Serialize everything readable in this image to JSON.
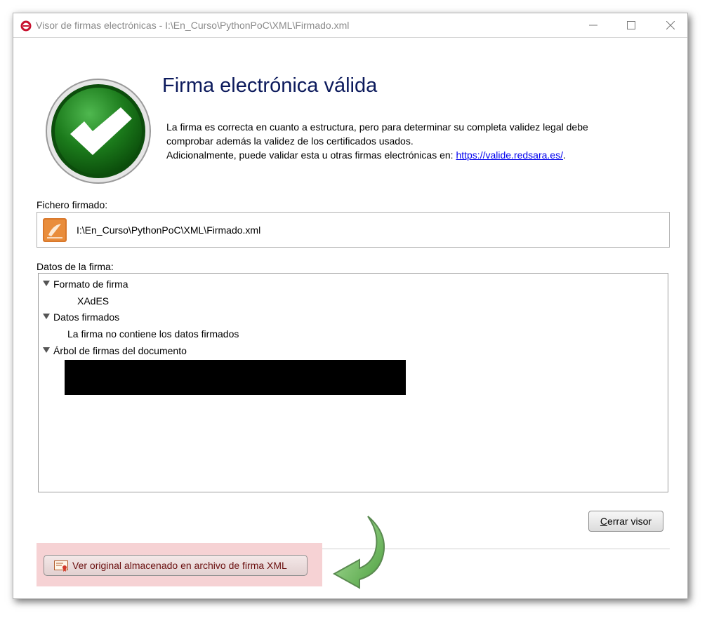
{
  "window": {
    "title": "Visor de firmas electrónicas - I:\\En_Curso\\PythonPoC\\XML\\Firmado.xml",
    "controls": {
      "minimize_icon": "minimize-icon",
      "maximize_icon": "maximize-icon",
      "close_icon": "close-icon"
    }
  },
  "status": {
    "icon": "check-circle-icon",
    "heading": "Firma electrónica válida",
    "description_line1": "La firma es correcta en cuanto a estructura, pero para determinar su completa validez legal debe",
    "description_line2": "comprobar además la validez de los certificados usados.",
    "description_line3": "Adicionalmente, puede validar esta u otras firmas electrónicas en: ",
    "link_text": "https://valide.redsara.es/",
    "after_link": "."
  },
  "file": {
    "label": "Fichero firmado:",
    "icon": "xml-file-icon",
    "path": "I:\\En_Curso\\PythonPoC\\XML\\Firmado.xml"
  },
  "signature_data": {
    "label": "Datos de la firma:",
    "tree": [
      {
        "label": "Formato de firma",
        "child": "XAdES"
      },
      {
        "label": "Datos firmados",
        "child": "La firma no contiene los datos firmados"
      },
      {
        "label": "Árbol de firmas del documento"
      }
    ]
  },
  "buttons": {
    "close_accel": "C",
    "close_rest": "errar visor",
    "view_original": "Ver original almacenado en archivo de firma XML"
  },
  "colors": {
    "heading": "#0c1a5c",
    "check_green": "#1b7a1b",
    "highlight": "#f6d2d4",
    "arrow_green": "#6bbf5a"
  }
}
